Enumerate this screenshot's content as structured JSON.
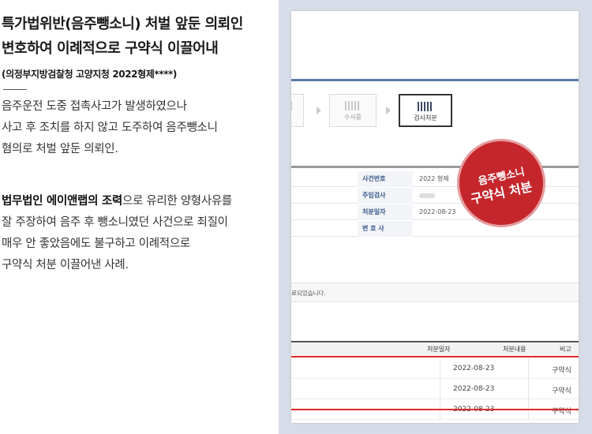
{
  "article": {
    "title_line1": "특가법위반(음주뺑소니) 처벌 앞둔 의뢰인",
    "title_line2": "변호하여 이례적으로 구약식 이끌어내",
    "case_no": "(의정부지방검찰청 고양지청 2022형제****)",
    "para1": [
      "음주운전 도중 접촉사고가 발생하였으나",
      "사고 후 조치를 하지 않고 도주하여 음주뺑소니",
      "혐의로 처벌 앞둔 의뢰인."
    ],
    "para2": {
      "line1_strong": "법무법인 에이앤랩의 조력",
      "line1_rest": "으로 유리한 양형사유를",
      "lines": [
        "잘 주장하여 음주 후 뺑소니였던 사건으로 죄질이",
        "매우 안 좋았음에도 불구하고 이례적으로",
        "구약식 처분 이끌어낸 사례."
      ]
    }
  },
  "screenshot": {
    "steps": [
      {
        "label": ""
      },
      {
        "label": "수사중"
      },
      {
        "label": "검사처분"
      }
    ],
    "info_rows": [
      {
        "key": "사건번호",
        "value": "2022 형제"
      },
      {
        "key": "주임검사",
        "value": ""
      },
      {
        "key": "처분일자",
        "value": "2022-08-23"
      },
      {
        "key": "변 호 사",
        "value": ""
      }
    ],
    "notice": "료되었습니다.",
    "table_headers": [
      "처분일자",
      "처분내용",
      "비고"
    ],
    "table_rows": [
      {
        "date": "2022-08-23",
        "type": "구약식"
      },
      {
        "date": "2022-08-23",
        "type": "구약식"
      },
      {
        "date": "2022-08-23",
        "type": "구약식"
      }
    ],
    "stamp": {
      "line1": "음주뺑소니",
      "line2": "구약식 처분"
    }
  },
  "colors": {
    "stamp": "#c4262c",
    "highlight_line": "#e02a2a",
    "panel_bg": "#d7dde8"
  }
}
